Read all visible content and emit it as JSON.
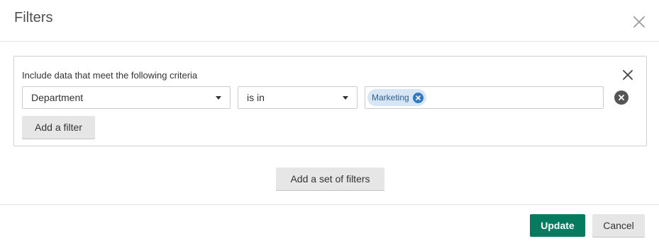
{
  "dialog": {
    "title": "Filters"
  },
  "filter_set": {
    "criteria_label": "Include data that meet the following criteria",
    "filters": [
      {
        "field": "Department",
        "operator": "is in",
        "values": [
          "Marketing"
        ]
      }
    ],
    "add_filter_label": "Add a filter"
  },
  "add_set_label": "Add a set of filters",
  "footer": {
    "update_label": "Update",
    "cancel_label": "Cancel"
  },
  "colors": {
    "primary": "#047a5f",
    "tag_background": "#d6e6f5",
    "tag_text": "#2f5f8c",
    "tag_remove": "#2f78c4"
  }
}
